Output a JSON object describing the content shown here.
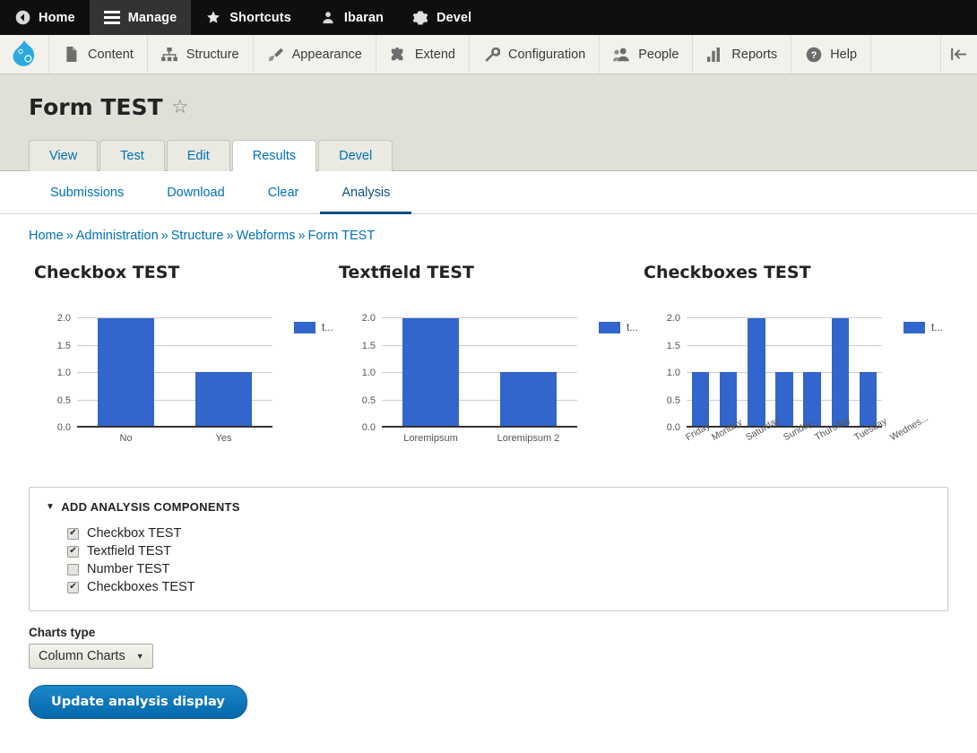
{
  "toolbar_top": {
    "items": [
      {
        "label": "Home",
        "icon": "back-circle-icon",
        "active": false
      },
      {
        "label": "Manage",
        "icon": "hamburger-icon",
        "active": true
      },
      {
        "label": "Shortcuts",
        "icon": "star-icon",
        "active": false
      },
      {
        "label": "Ibaran",
        "icon": "user-icon",
        "active": false
      },
      {
        "label": "Devel",
        "icon": "gear-icon",
        "active": false
      }
    ]
  },
  "toolbar_menu": {
    "logo": "drupal-logo",
    "items": [
      {
        "label": "Content",
        "icon": "document-icon"
      },
      {
        "label": "Structure",
        "icon": "sitemap-icon"
      },
      {
        "label": "Appearance",
        "icon": "paintbrush-icon"
      },
      {
        "label": "Extend",
        "icon": "puzzle-icon"
      },
      {
        "label": "Configuration",
        "icon": "wrench-icon"
      },
      {
        "label": "People",
        "icon": "people-icon"
      },
      {
        "label": "Reports",
        "icon": "bar-chart-icon"
      },
      {
        "label": "Help",
        "icon": "question-circle-icon"
      }
    ],
    "collapse_icon": "collapse-left-icon"
  },
  "header": {
    "title": "Form TEST",
    "star_icon": "star-outline-icon"
  },
  "primary_tabs": [
    {
      "label": "View",
      "active": false
    },
    {
      "label": "Test",
      "active": false
    },
    {
      "label": "Edit",
      "active": false
    },
    {
      "label": "Results",
      "active": true
    },
    {
      "label": "Devel",
      "active": false
    }
  ],
  "secondary_tabs": [
    {
      "label": "Submissions",
      "active": false
    },
    {
      "label": "Download",
      "active": false
    },
    {
      "label": "Clear",
      "active": false
    },
    {
      "label": "Analysis",
      "active": true
    }
  ],
  "breadcrumb": {
    "separator": "»",
    "items": [
      "Home",
      "Administration",
      "Structure",
      "Webforms",
      "Form TEST"
    ]
  },
  "chart_data": [
    {
      "type": "bar",
      "title": "Checkbox TEST",
      "categories": [
        "No",
        "Yes"
      ],
      "values": [
        2,
        1
      ],
      "series": [
        {
          "name": "t...",
          "values": [
            2,
            1
          ]
        }
      ],
      "xlabel": "",
      "ylabel": "",
      "ylim": [
        0,
        2
      ],
      "yticks": [
        "0.0",
        "0.5",
        "1.0",
        "1.5",
        "2.0"
      ],
      "grid": true,
      "legend": {
        "position": "right",
        "entries": [
          "t..."
        ]
      },
      "color": "#3366cc",
      "rotated_labels": false
    },
    {
      "type": "bar",
      "title": "Textfield TEST",
      "categories": [
        "Loremipsum",
        "Loremipsum 2"
      ],
      "values": [
        2,
        1
      ],
      "series": [
        {
          "name": "t...",
          "values": [
            2,
            1
          ]
        }
      ],
      "xlabel": "",
      "ylabel": "",
      "ylim": [
        0,
        2
      ],
      "yticks": [
        "0.0",
        "0.5",
        "1.0",
        "1.5",
        "2.0"
      ],
      "grid": true,
      "legend": {
        "position": "right",
        "entries": [
          "t..."
        ]
      },
      "color": "#3366cc",
      "rotated_labels": false
    },
    {
      "type": "bar",
      "title": "Checkboxes TEST",
      "categories": [
        "Friday",
        "Monday",
        "Saturday",
        "Sunday",
        "Thursday",
        "Tuesday",
        "Wednes..."
      ],
      "values": [
        1,
        1,
        2,
        1,
        1,
        2,
        1
      ],
      "series": [
        {
          "name": "t...",
          "values": [
            1,
            1,
            2,
            1,
            1,
            2,
            1
          ]
        }
      ],
      "xlabel": "",
      "ylabel": "",
      "ylim": [
        0,
        2
      ],
      "yticks": [
        "0.0",
        "0.5",
        "1.0",
        "1.5",
        "2.0"
      ],
      "grid": true,
      "legend": {
        "position": "right",
        "entries": [
          "t..."
        ]
      },
      "color": "#3366cc",
      "rotated_labels": true
    }
  ],
  "analysis_components": {
    "legend": "ADD ANALYSIS COMPONENTS",
    "arrow": "▼",
    "items": [
      {
        "label": "Checkbox TEST",
        "checked": true
      },
      {
        "label": "Textfield TEST",
        "checked": true
      },
      {
        "label": "Number TEST",
        "checked": false
      },
      {
        "label": "Checkboxes TEST",
        "checked": true
      }
    ]
  },
  "form_footer": {
    "charts_type_label": "Charts type",
    "charts_type_value": "Column Charts",
    "charts_type_options": [
      "Column Charts"
    ],
    "submit_label": "Update analysis display"
  }
}
